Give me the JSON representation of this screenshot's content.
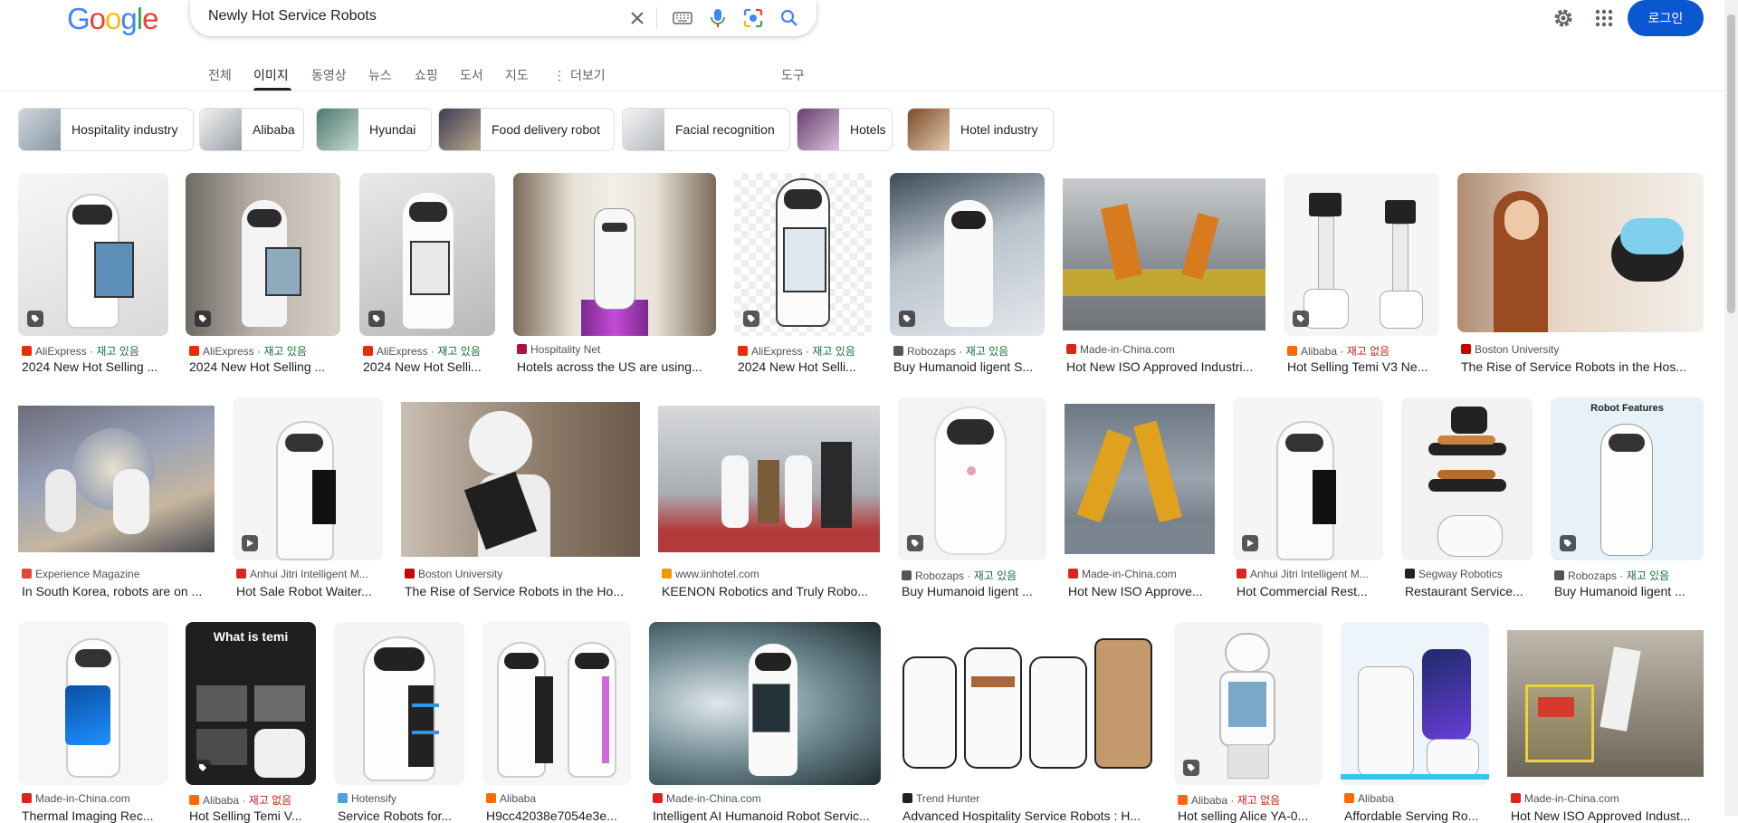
{
  "logo": {
    "letters": [
      "G",
      "o",
      "o",
      "g",
      "l",
      "e"
    ],
    "colors": [
      "#4285f4",
      "#ea4335",
      "#fbbc05",
      "#4285f4",
      "#34a853",
      "#ea4335"
    ]
  },
  "search": {
    "query": "Newly Hot Service Robots"
  },
  "header": {
    "login_label": "로그인"
  },
  "tabs": [
    {
      "label": "전체",
      "active": false
    },
    {
      "label": "이미지",
      "active": true
    },
    {
      "label": "동영상",
      "active": false
    },
    {
      "label": "뉴스",
      "active": false
    },
    {
      "label": "쇼핑",
      "active": false
    },
    {
      "label": "도서",
      "active": false
    },
    {
      "label": "지도",
      "active": false
    },
    {
      "label": "더보기",
      "active": false
    }
  ],
  "tools_label": "도구",
  "chips": [
    {
      "label": "Hospitality industry"
    },
    {
      "label": "Alibaba"
    },
    {
      "label": "Hyundai"
    },
    {
      "label": "Food delivery robot"
    },
    {
      "label": "Facial recognition"
    },
    {
      "label": "Hotels"
    },
    {
      "label": "Hotel industry"
    }
  ],
  "results": [
    {
      "source": "AliExpress",
      "stock": "재고 있음",
      "title": "2024 New Hot Selling ...",
      "fav": "#e62e04"
    },
    {
      "source": "AliExpress",
      "stock": "재고 있음",
      "title": "2024 New Hot Selling ...",
      "fav": "#e62e04"
    },
    {
      "source": "AliExpress",
      "stock": "재고 있음",
      "title": "2024 New Hot Selli...",
      "fav": "#e62e04"
    },
    {
      "source": "Hospitality Net",
      "stock": "",
      "title": "Hotels across the US are using...",
      "fav": "#b0123c"
    },
    {
      "source": "AliExpress",
      "stock": "재고 있음",
      "title": "2024 New Hot Selli...",
      "fav": "#e62e04"
    },
    {
      "source": "Robozaps",
      "stock": "재고 있음",
      "title": "Buy Humanoid ligent S...",
      "fav": "#555555"
    },
    {
      "source": "Made-in-China.com",
      "stock": "",
      "title": "Hot New ISO Approved Industri...",
      "fav": "#d9261c"
    },
    {
      "source": "Alibaba",
      "stock": "재고 없음",
      "title": "Hot Selling Temi V3 Ne...",
      "fav": "#ff6a00"
    },
    {
      "source": "Boston University",
      "stock": "",
      "title": "The Rise of Service Robots in the Hos...",
      "fav": "#cc0000"
    },
    {
      "source": "Experience Magazine",
      "stock": "",
      "title": "In South Korea, robots are on ...",
      "fav": "#e8453c"
    },
    {
      "source": "Anhui Jitri Intelligent M...",
      "stock": "",
      "title": "Hot Sale Robot Waiter...",
      "fav": "#d9261c"
    },
    {
      "source": "Boston University",
      "stock": "",
      "title": "The Rise of Service Robots in the Ho...",
      "fav": "#cc0000"
    },
    {
      "source": "www.iinhotel.com",
      "stock": "",
      "title": "KEENON Robotics and Truly Robo...",
      "fav": "#f29900"
    },
    {
      "source": "Robozaps",
      "stock": "재고 있음",
      "title": "Buy Humanoid ligent ...",
      "fav": "#555555"
    },
    {
      "source": "Made-in-China.com",
      "stock": "",
      "title": "Hot New ISO Approve...",
      "fav": "#d9261c"
    },
    {
      "source": "Anhui Jitri Intelligent M...",
      "stock": "",
      "title": "Hot Commercial Rest...",
      "fav": "#d9261c"
    },
    {
      "source": "Segway Robotics",
      "stock": "",
      "title": "Restaurant Service...",
      "fav": "#202124"
    },
    {
      "source": "Robozaps",
      "stock": "재고 있음",
      "title": "Buy Humanoid ligent ...",
      "fav": "#555555"
    },
    {
      "source": "Made-in-China.com",
      "stock": "",
      "title": "Thermal Imaging Rec...",
      "fav": "#d9261c"
    },
    {
      "source": "Alibaba",
      "stock": "재고 없음",
      "title": "Hot Selling Temi V...",
      "fav": "#ff6a00"
    },
    {
      "source": "Hotensify",
      "stock": "",
      "title": "Service Robots for...",
      "fav": "#4aa3df"
    },
    {
      "source": "Alibaba",
      "stock": "",
      "title": "H9cc42038e7054e3e...",
      "fav": "#ff6a00"
    },
    {
      "source": "Made-in-China.com",
      "stock": "",
      "title": "Intelligent AI Humanoid Robot Servic...",
      "fav": "#d9261c"
    },
    {
      "source": "Trend Hunter",
      "stock": "",
      "title": "Advanced Hospitality Service Robots : H...",
      "fav": "#202124"
    },
    {
      "source": "Alibaba",
      "stock": "재고 없음",
      "title": "Hot selling Alice YA-0...",
      "fav": "#ff6a00"
    },
    {
      "source": "Alibaba",
      "stock": "",
      "title": "Affordable Serving Ro...",
      "fav": "#ff6a00"
    },
    {
      "source": "Made-in-China.com",
      "stock": "",
      "title": "Hot New ISO Approved Indust...",
      "fav": "#d9261c"
    }
  ],
  "image_text": {
    "what_is_temi": "What is temi",
    "robot_features": "Robot Features"
  }
}
